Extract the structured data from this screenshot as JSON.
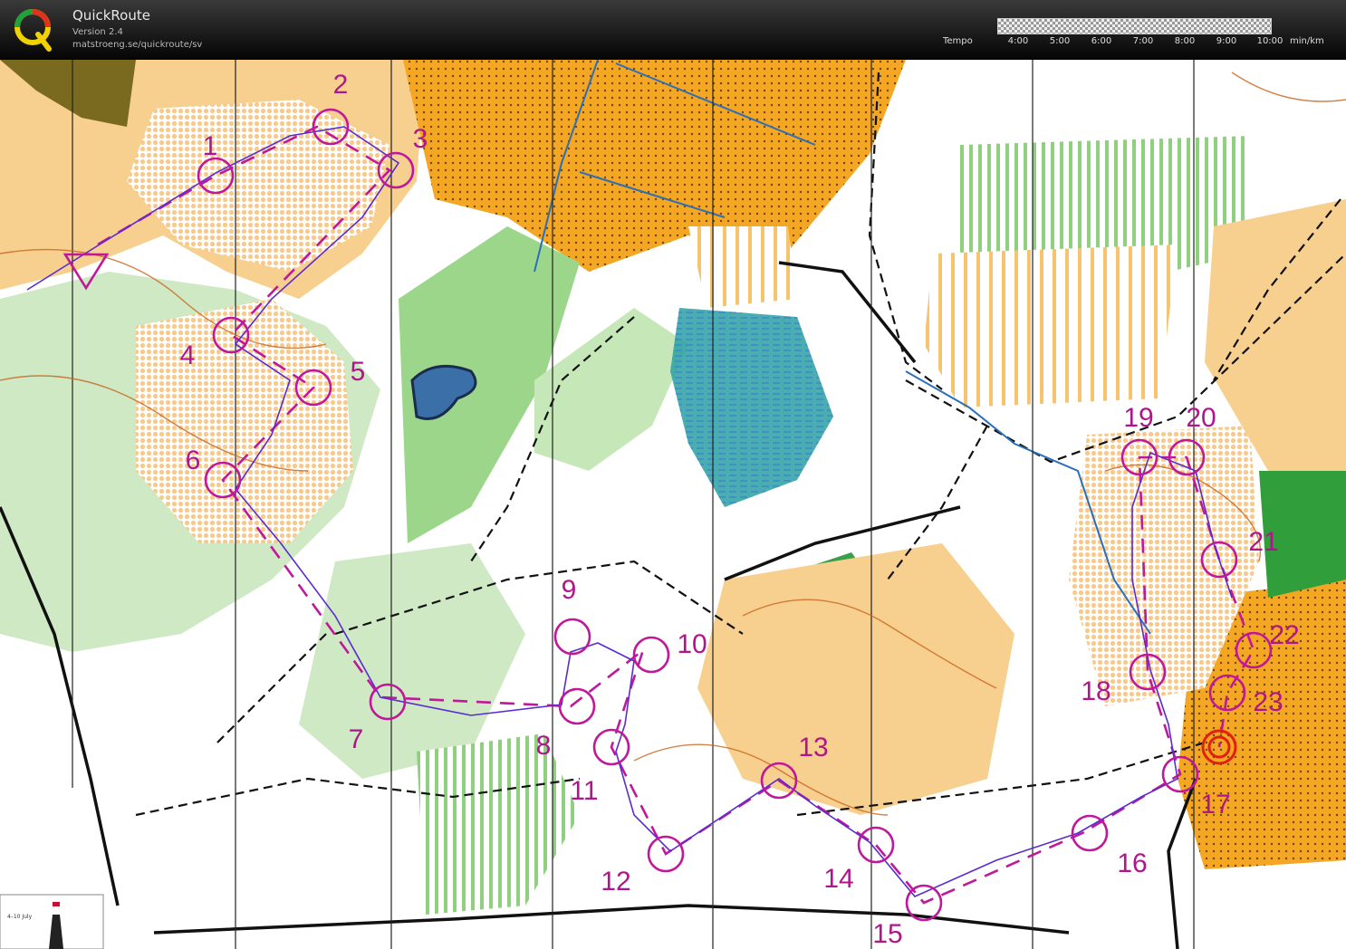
{
  "header": {
    "app_title": "QuickRoute",
    "version": "Version 2.4",
    "url": "matstroeng.se/quickroute/sv",
    "tempo_label": "Tempo",
    "tempo_ticks": [
      "4:00",
      "5:00",
      "6:00",
      "7:00",
      "8:00",
      "9:00",
      "10:00"
    ],
    "tempo_unit": "min/km",
    "logo_letter": "Q"
  },
  "course": {
    "color": "#c0189a",
    "route_color": "#5a2bd0",
    "controls": [
      "1",
      "2",
      "3",
      "4",
      "5",
      "6",
      "7",
      "8",
      "9",
      "10",
      "11",
      "12",
      "13",
      "14",
      "15",
      "16",
      "17",
      "18",
      "19",
      "20",
      "21",
      "22",
      "23"
    ]
  },
  "map_legend_box": {
    "text": "4–10 July"
  }
}
